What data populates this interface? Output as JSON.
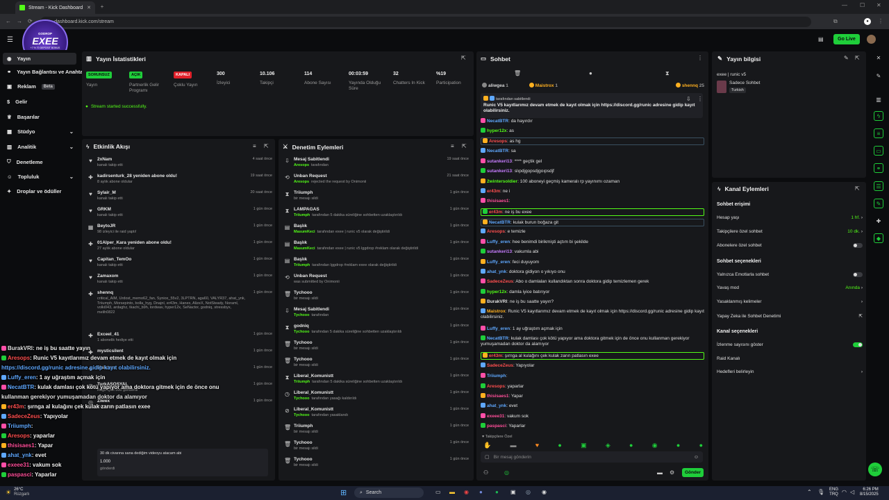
{
  "browser": {
    "tab_title": "Stream - Kick Dashboard",
    "url": "dashboard.kick.com/stream"
  },
  "header": {
    "go_live": "Go Live"
  },
  "sidebar": {
    "items": [
      {
        "label": "Yayın"
      },
      {
        "label": "Yayın Bağlantısı ve Anahtarı"
      },
      {
        "label": "Reklam",
        "badge": "Beta"
      },
      {
        "label": "Gelir"
      },
      {
        "label": "Başarılar"
      },
      {
        "label": "Stüdyo"
      },
      {
        "label": "Analitik"
      },
      {
        "label": "Denetleme"
      },
      {
        "label": "Topluluk"
      },
      {
        "label": "Droplar ve ödüller"
      }
    ]
  },
  "overlay_logo": {
    "name": "EXEE",
    "top": "GODROP",
    "sub": "+7 % 70 DEPOSIT BONUS\nFREE SPINS"
  },
  "stats": {
    "title": "Yayın İstatistikleri",
    "items": [
      {
        "value": "SORUNSUZ",
        "label": "Yayın",
        "color": "#1fce3a"
      },
      {
        "value": "AÇIK",
        "label": "Partnerlik Gelir Programı",
        "color": "#1fce3a"
      },
      {
        "value": "KAPALI",
        "label": "Çoklu Yayın",
        "color": "#e0202a"
      },
      {
        "value": "300",
        "label": "İzleyici"
      },
      {
        "value": "10.106",
        "label": "Takipçi"
      },
      {
        "value": "114",
        "label": "Abone Sayısı"
      },
      {
        "value": "00:03:59",
        "label": "Yayında Olduğu Süre"
      },
      {
        "value": "32",
        "label": "Chatters In Kick"
      },
      {
        "value": "%19",
        "label": "Participation"
      }
    ],
    "status": "Stream started successfully."
  },
  "activity": {
    "title": "Etkinlik Akışı",
    "rows": [
      {
        "title": "2xNam",
        "sub": "kanalı takip etti",
        "time": "4 saat önce"
      },
      {
        "title": "kadirsenturk_28 yeniden abone oldu!",
        "sub": "8 aylık abone oldular",
        "time": "19 saat önce"
      },
      {
        "title": "Sylair_M",
        "sub": "kanalı takip etti",
        "time": "20 saat önce"
      },
      {
        "title": "GRKM",
        "sub": "kanalı takip etti",
        "time": "1 gün önce"
      },
      {
        "title": "BeytoJR",
        "sub": "98 izleyici ile raid yaptı!",
        "time": "1 gün önce"
      },
      {
        "title": "01Alper_Kara yeniden abone oldu!",
        "sub": "27 aylık abone oldular",
        "time": "1 gün önce"
      },
      {
        "title": "Capitan_TemOo",
        "sub": "kanalı takip etti",
        "time": "1 gün önce"
      },
      {
        "title": "Zamaxom",
        "sub": "kanalı takip etti",
        "time": "1 gün önce"
      },
      {
        "title": "shennq",
        "sub": "critical_AIM, Urdost_memo62_fan, Syniox_55v2, 3LPTRN, aga60, VALYR37, ahat_ynk, Triiumph, Morsepinto, bolla_hyg, Dnajnl, er43m, Hanex, AlizeX, NotSteady, Noraml, volki043, ardaghz, tkachi_b9h, lordwav, hyper12x, SeNactor, godniq, stressbyx, melih0822",
        "time": "1 gün önce"
      },
      {
        "title": "Exceel_41",
        "sub": "1 abonelik hediye etti",
        "time": "1 gün önce"
      },
      {
        "title": "mysticsilent",
        "sub": "",
        "time": "1 gün önce"
      },
      {
        "title": "Maistrox",
        "sub": "",
        "time": "1 gün önce"
      },
      {
        "title": "TurkASOSYAL",
        "sub": "Rage Quit 500 gönderdi",
        "time": "1 gün önce"
      },
      {
        "title": "Ziwex",
        "sub": "Pack It Up",
        "time": "1 gün önce"
      }
    ],
    "card_text": "30 dk civarına sana dediğim videoyu atacam abi",
    "card_amount": "1.000",
    "card_footer": "gönderdi"
  },
  "moderation": {
    "title": "Denetim Eylemleri",
    "rows": [
      {
        "title": "Mesaj Sabitlendi",
        "actor": "Aresops",
        "sub": "tarafından",
        "time": "19 saat önce"
      },
      {
        "title": "Unban Request",
        "actor": "Aresops",
        "sub": "rejected the request by Onimonii",
        "time": "21 saat önce"
      },
      {
        "title": "Triiumph",
        "actor": "",
        "sub": "bir mesajı sildi",
        "time": "1 gün önce"
      },
      {
        "title": "LAMPAGAS",
        "actor": "Triiumph",
        "sub": "tarafından 5 dakika süreliğine sohbetten uzaklaştırıldı",
        "time": "1 gün önce"
      },
      {
        "title": "Başlık",
        "actor": "MasumKeci",
        "sub": "tarafından exee | runic v5 olarak değiştirildi",
        "time": "1 gün önce"
      },
      {
        "title": "Başlık",
        "actor": "MasumKeci",
        "sub": "tarafından exee | runic v5 lggdrop #reklam olarak değiştirildi",
        "time": "1 gün önce"
      },
      {
        "title": "Başlık",
        "actor": "Triiumph",
        "sub": "tarafından lggdrop #reklam exee olarak değiştirildi",
        "time": "1 gün önce"
      },
      {
        "title": "Unban Request",
        "actor": "",
        "sub": "was submitted by Onimonii",
        "time": "1 gün önce"
      },
      {
        "title": "Tychooo",
        "actor": "",
        "sub": "bir mesajı sildi",
        "time": "1 gün önce"
      },
      {
        "title": "Mesaj Sabitlendi",
        "actor": "Tychooo",
        "sub": "tarafından",
        "time": "1 gün önce"
      },
      {
        "title": "godniq",
        "actor": "Tychooo",
        "sub": "tarafından 5 dakika süreliğine sohbetten uzaklaştırıldı",
        "time": "1 gün önce"
      },
      {
        "title": "Tychooo",
        "actor": "",
        "sub": "bir mesajı sildi",
        "time": "1 gün önce"
      },
      {
        "title": "Tychooo",
        "actor": "",
        "sub": "bir mesajı sildi",
        "time": "1 gün önce"
      },
      {
        "title": "Liberal_Komunistt",
        "actor": "Triiumph",
        "sub": "tarafından 5 dakika süreliğine sohbetten uzaklaştırıldı",
        "time": "1 gün önce"
      },
      {
        "title": "Liberal_Komunistt",
        "actor": "Tychooo",
        "sub": "tarafından yasağı kaldırıldı",
        "time": "1 gün önce"
      },
      {
        "title": "Liberal_Komunistt",
        "actor": "Tychooo",
        "sub": "tarafından yasaklandı",
        "time": "1 gün önce"
      },
      {
        "title": "Triiumph",
        "actor": "",
        "sub": "bir mesajı sildi",
        "time": "1 gün önce"
      },
      {
        "title": "Tychooo",
        "actor": "",
        "sub": "bir mesajı sildi",
        "time": "1 gün önce"
      },
      {
        "title": "Tychooo",
        "actor": "",
        "sub": "bir mesajı sildi",
        "time": "1 gün önce"
      }
    ]
  },
  "chat": {
    "title": "Sohbet",
    "top_users": [
      {
        "name": "aliwgea",
        "value": "1"
      },
      {
        "name": "Maistrox",
        "value": "1"
      },
      {
        "name": "shennq",
        "value": "25"
      }
    ],
    "pinned_by": "tarafından sabitlendi",
    "pinned_text": "Runic V5 kayıtlarımız devam etmek de kayıt olmak için https://discord.gg/runic adresine gidip kayıt olabilirsiniz.",
    "messages": [
      {
        "user": "NecatBTR",
        "color": "#5fa8ff",
        "text": "da hayırdır"
      },
      {
        "user": "hyper12x",
        "color": "#53fc18",
        "text": "as"
      },
      {
        "user": "Aresops",
        "color": "#ff4f4f",
        "text": "as hg",
        "style": "box"
      },
      {
        "user": "NecatBTR",
        "color": "#5fa8ff",
        "text": "sa"
      },
      {
        "user": "sutankeri13",
        "color": "#c77dff",
        "text": "**** geçtik gel"
      },
      {
        "user": "sutankeri13",
        "color": "#c77dff",
        "text": "slıpdjgopsdjgoıpsdjf"
      },
      {
        "user": "2wintersoldier",
        "color": "#53fc18",
        "text": "100 aboneyi geçmiş kameralı rp yayınımı ozaman"
      },
      {
        "user": "er43m",
        "color": "#ff4f4f",
        "text": "ne i"
      },
      {
        "user": "thisisaes1",
        "color": "#ff4f9a",
        "text": ""
      },
      {
        "user": "er43m",
        "color": "#ff4f4f",
        "text": "ne iş bu exee",
        "style": "hl"
      },
      {
        "user": "NecatBTR",
        "color": "#5fa8ff",
        "text": "kulak burun boğaza git",
        "style": "box"
      },
      {
        "user": "Aresops",
        "color": "#ff4f4f",
        "text": "e temizle"
      },
      {
        "user": "Luffy_eren",
        "color": "#5fa8ff",
        "text": "hee benimdi birikmişti açtım bi şekilde"
      },
      {
        "user": "sutankeri13",
        "color": "#c77dff",
        "text": "vakumla abi"
      },
      {
        "user": "Luffy_eren",
        "color": "#5fa8ff",
        "text": "feci duyuyom"
      },
      {
        "user": "ahat_ynk",
        "color": "#5fa8ff",
        "text": "doktora gidiyon o yıkıyo onu"
      },
      {
        "user": "SadeceZeus",
        "color": "#ff4f4f",
        "text": "Abo o damlaları kullandıktan sonra doktora gidip temizlemen gerek"
      },
      {
        "user": "hyper12x",
        "color": "#53fc18",
        "text": "damla iyice batırıyor"
      },
      {
        "user": "BurakVRI",
        "color": "#e0e0e0",
        "text": "ne iş bu saatte yayın?"
      },
      {
        "user": "Maistrox",
        "color": "#ffb020",
        "text": "Runic V5 kayıtlarımız devam etmek de kayıt olmak için https://discord.gg/runic adresine gidip kayıt olabilirsiniz."
      },
      {
        "user": "Luffy_eren",
        "color": "#5fa8ff",
        "text": "1 ay uğraştım açmak için"
      },
      {
        "user": "NecatBTR",
        "color": "#5fa8ff",
        "text": "kulak damlası çok kötü yapıyor ama doktora gitmek için de önce onu kullanman gerekiyor yumuşamadan doktor da alamıyor"
      },
      {
        "user": "er43m",
        "color": "#ff4f4f",
        "text": "şırnga al kulağını çek kulak zarın patlasın exee",
        "style": "hl"
      },
      {
        "user": "SadeceZeus",
        "color": "#ff4f4f",
        "text": "Yapıyolar"
      },
      {
        "user": "Triiumph",
        "color": "#5fa8ff",
        "text": ""
      },
      {
        "user": "Aresops",
        "color": "#ff4f4f",
        "text": "yaparlar"
      },
      {
        "user": "thisisaes1",
        "color": "#ff4f9a",
        "text": "Yapar"
      },
      {
        "user": "ahat_ynk",
        "color": "#5fa8ff",
        "text": "evet"
      },
      {
        "user": "exeee31",
        "color": "#ff4f9a",
        "text": "vakum sok"
      },
      {
        "user": "paspasci",
        "color": "#ff4f9a",
        "text": "Yaparlar"
      }
    ],
    "followers_only": "Takipçilere Özel",
    "input_placeholder": "Bir mesaj gönderin",
    "send": "Gönder"
  },
  "stream_info": {
    "title": "Yayın bilgisi",
    "stream_title": "exee | runic v5",
    "category": "Sadece Sohbet",
    "tag": "Turkish"
  },
  "channel_actions": {
    "title": "Kanal Eylemleri",
    "chat_access_title": "Sohbet erişimi",
    "access_rows": [
      {
        "label": "Hesap yaşı",
        "value": "1 hf."
      },
      {
        "label": "Takipçilere özel sohbet",
        "value": "10 dk."
      },
      {
        "label": "Abonelere özel sohbet",
        "toggle": false
      }
    ],
    "chat_options_title": "Sohbet seçenekleri",
    "option_rows": [
      {
        "label": "Yalnızca Emotlarla sohbet",
        "toggle": false
      },
      {
        "label": "Yavaş mod",
        "value": "Anında"
      },
      {
        "label": "Yasaklanmış kelimeler",
        "value": ""
      },
      {
        "label": "Yapay Zeka ile Sohbet Denetimi",
        "value": ""
      }
    ],
    "channel_options_title": "Kanal seçenekleri",
    "channel_rows": [
      {
        "label": "İzlenme sayısını göster",
        "toggle": true
      },
      {
        "label": "Raid Kanalı",
        "value": ""
      },
      {
        "label": "Hedefleri belirleyin",
        "value": ""
      }
    ]
  },
  "stream_overlay_chat": [
    {
      "user": "BurakVRI",
      "color": "#e0e0e0",
      "text": ": ne iş bu saatte yayın"
    },
    {
      "user": "Aresops",
      "color": "#ff4f4f",
      "text": ": Runic V5 kayıtlarımız devam etmek de kayıt olmak için"
    },
    {
      "user": "",
      "color": "#5fa8ff",
      "text": "https://discord.gg/runic adresine gidip kayıt olabilirsiniz."
    },
    {
      "user": "Luffy_eren",
      "color": "#5fa8ff",
      "text": ": 1 ay uğraştım açmak için"
    },
    {
      "user": "NecatBTR",
      "color": "#5fa8ff",
      "text": ": kulak damlası çok kötü yapıyor ama doktora gitmek için de önce onu"
    },
    {
      "user": "",
      "color": "#e0e0e0",
      "text": "kullanman gerekiyor yumuşamadan doktor da alamıyor"
    },
    {
      "user": "er43m",
      "color": "#ff4f4f",
      "text": ": şırnga al kulağını çek kulak zarın patlasın exee"
    },
    {
      "user": "SadeceZeus",
      "color": "#ff4f4f",
      "text": ": Yapıyolar"
    },
    {
      "user": "Triiumph",
      "color": "#5fa8ff",
      "text": ":"
    },
    {
      "user": "Aresops",
      "color": "#ff4f4f",
      "text": ": yaparlar"
    },
    {
      "user": "thisisaes1",
      "color": "#ff4f9a",
      "text": ": Yapar"
    },
    {
      "user": "ahat_ynk",
      "color": "#5fa8ff",
      "text": ": evet"
    },
    {
      "user": "exeee31",
      "color": "#ff4f9a",
      "text": ": vakum sok"
    },
    {
      "user": "paspasci",
      "color": "#ff4f9a",
      "text": ": Yaparlar"
    }
  ],
  "taskbar": {
    "weather_temp": "26°C",
    "weather_desc": "Rüzgarlı",
    "search": "Search",
    "lang_top": "ENG",
    "lang_bottom": "TRQ",
    "time": "6:26 PM",
    "date": "8/15/2025"
  }
}
